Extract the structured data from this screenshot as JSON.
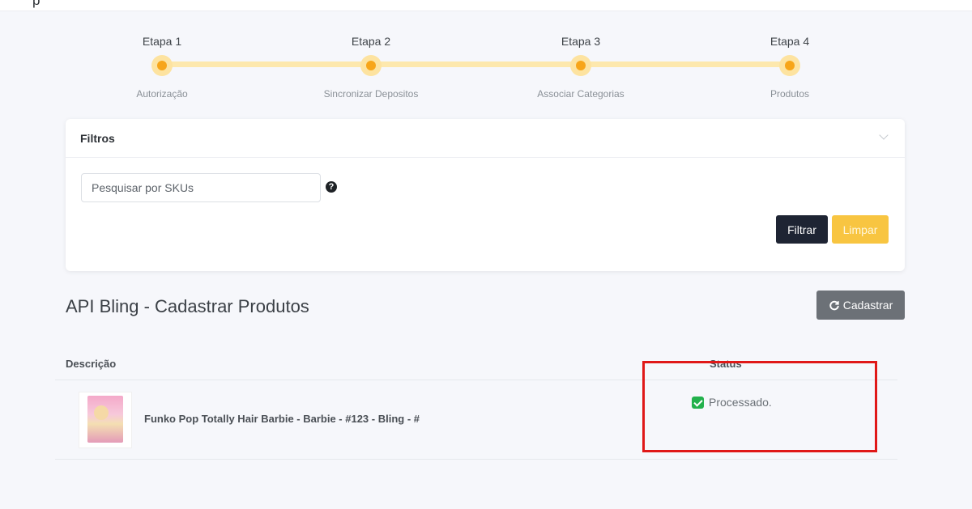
{
  "topbar": {
    "text": "p"
  },
  "stepper": {
    "steps": [
      {
        "title": "Etapa 1",
        "subtitle": "Autorização"
      },
      {
        "title": "Etapa 2",
        "subtitle": "Sincronizar Depositos"
      },
      {
        "title": "Etapa 3",
        "subtitle": "Associar Categorias"
      },
      {
        "title": "Etapa 4",
        "subtitle": "Produtos"
      }
    ]
  },
  "filters": {
    "title": "Filtros",
    "search_placeholder": "Pesquisar por SKUs",
    "help_icon": "?",
    "filter_label": "Filtrar",
    "clear_label": "Limpar"
  },
  "page": {
    "title": "API Bling - Cadastrar Produtos",
    "register_label": "Cadastrar"
  },
  "table": {
    "headers": {
      "description": "Descrição",
      "status": "Status"
    },
    "rows": [
      {
        "description": "Funko Pop Totally Hair Barbie - Barbie - #123 - Bling - #",
        "status": "Processado."
      }
    ]
  },
  "colors": {
    "accent": "#f7a519",
    "dark_button": "#1e2433",
    "yellow_button": "#f8c541",
    "success": "#22b14c",
    "highlight": "#e01818"
  }
}
